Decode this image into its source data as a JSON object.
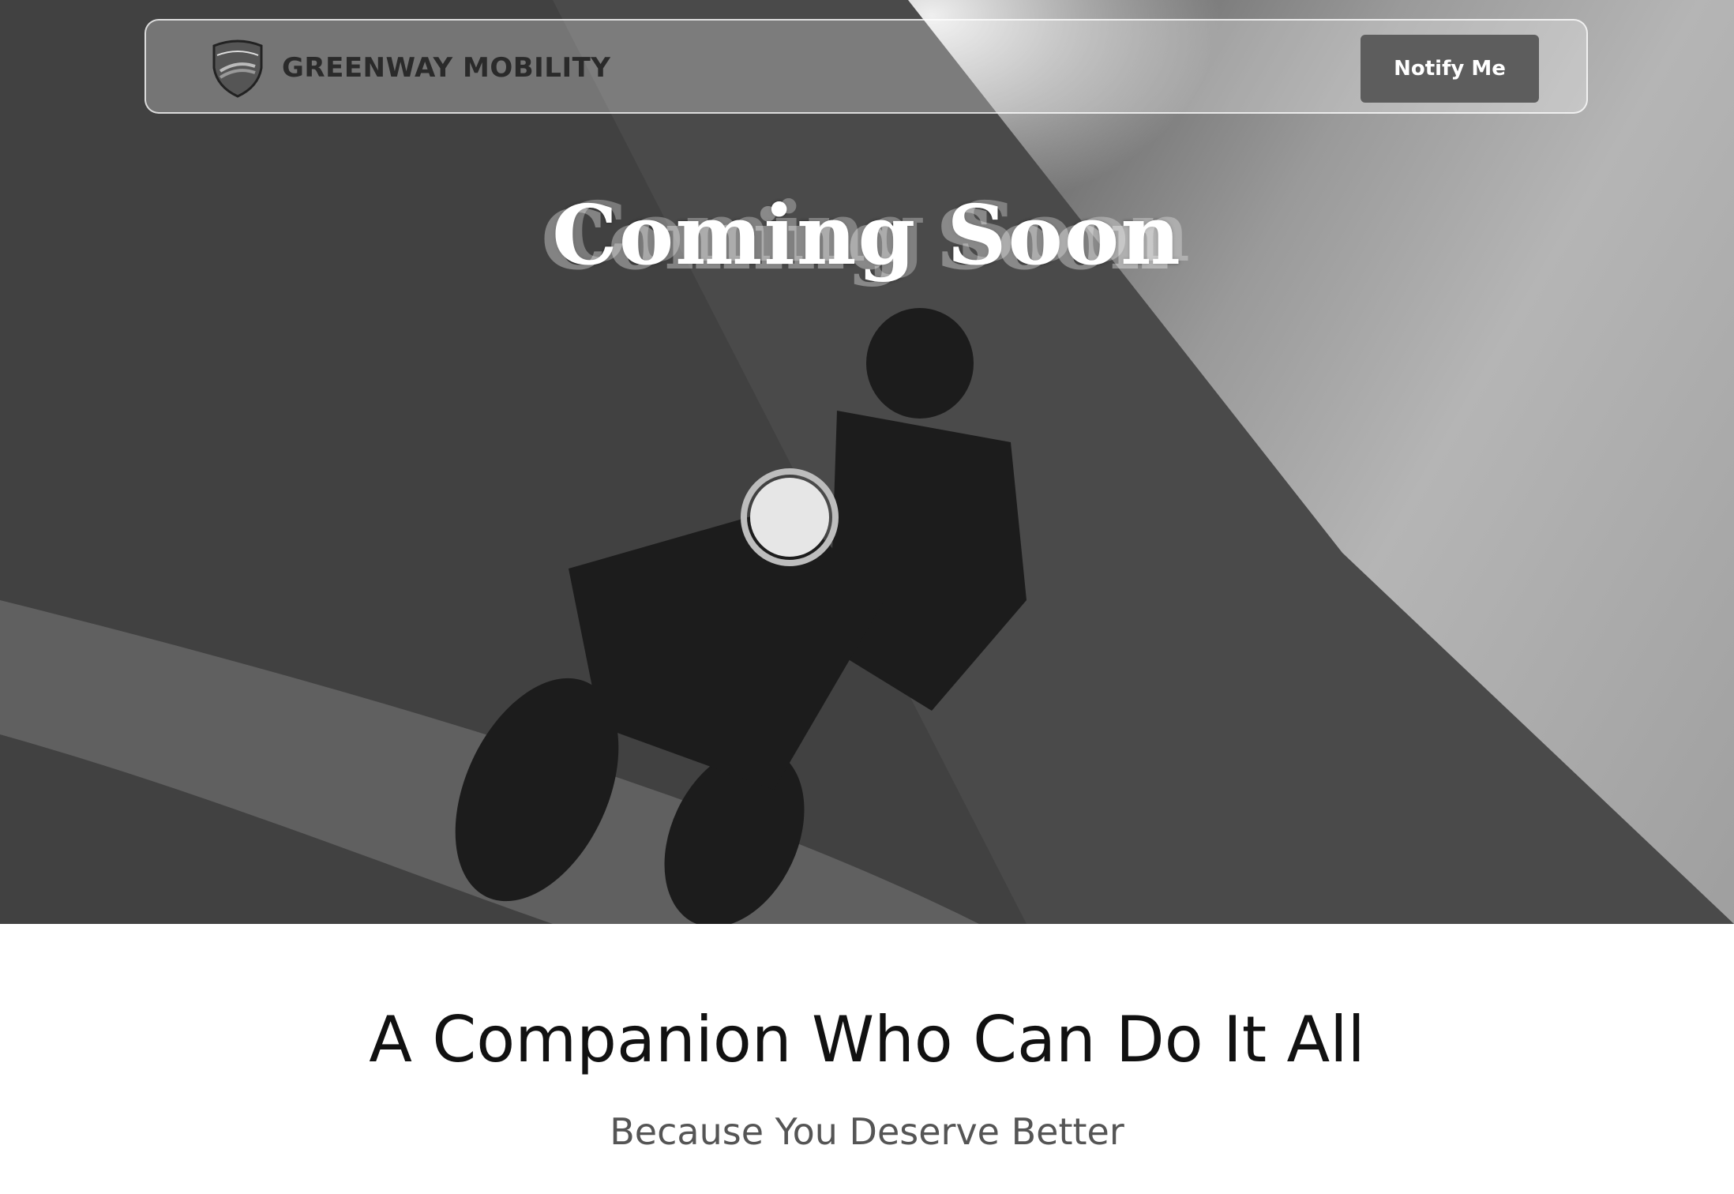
{
  "header": {
    "brand_name": "GREENWAY MOBILITY",
    "logo_text": "GREENWAY",
    "notify_button_label": "Notify Me"
  },
  "hero": {
    "coming_soon_text": "Coming Soon",
    "image_description_icon": "motorcycle-rider-photo"
  },
  "content": {
    "headline": "A Companion Who Can Do It All",
    "subheadline": "Because You Deserve Better"
  },
  "colors": {
    "button_bg": "#5d5d5d",
    "headline_text": "#111111",
    "subheadline_text": "#555555"
  }
}
